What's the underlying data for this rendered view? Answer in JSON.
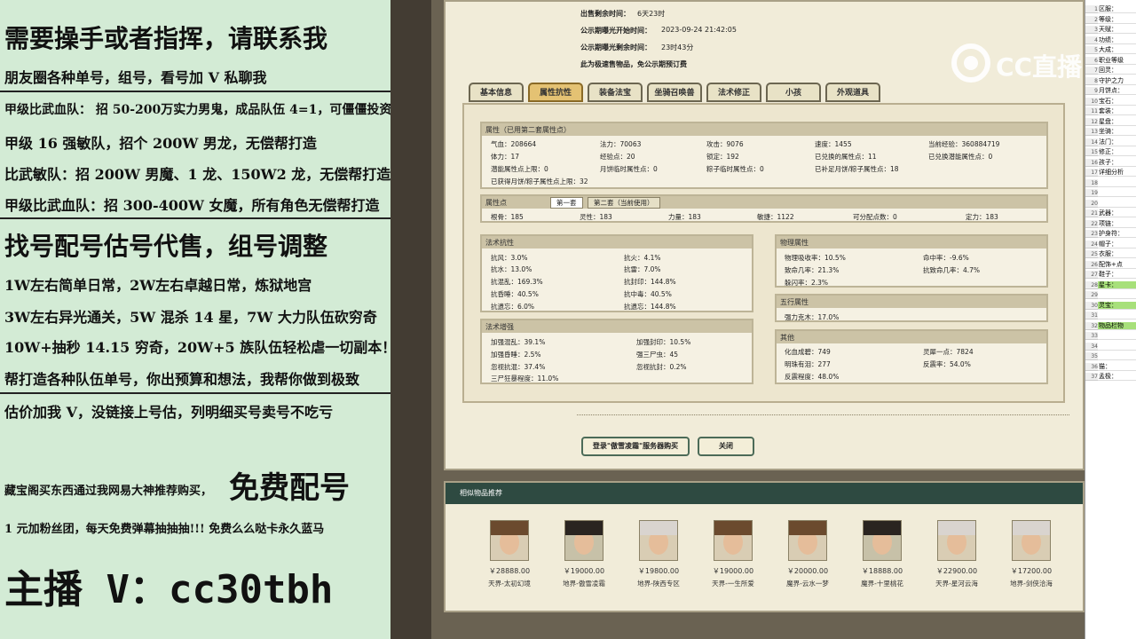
{
  "left_ad": {
    "line1": "需要操手或者指挥，请联系我",
    "line2": "朋友圈各种单号，组号，看号加 V 私聊我",
    "line3": "甲级比武血队： 招 50-200万实力男鬼，成品队伍 4=1，可僵僵投资",
    "line4": "甲级 16 强敏队，招个 200W 男龙，无偿帮打造",
    "line5": "比武敏队：招 200W 男魔、1 龙、150W2 龙，无偿帮打造",
    "line6": "甲级比武血队：招 300-400W 女魔，所有角色无偿帮打造",
    "line7": "找号配号估号代售，组号调整",
    "line8": "1W左右简单日常，2W左右卓越日常，炼狱地宫",
    "line9": "3W左右异光通关，5W 混杀 14 星，7W 大力队伍砍穷奇",
    "line10": "10W+抽秒 14.15 穷奇，20W+5 族队伍轻松虐一切副本！",
    "line11": "帮打造各种队伍单号，你出预算和想法，我帮你做到极致",
    "line12": "估价加我 V，没链接上号估，列明细买号卖号不吃亏",
    "line13a": "藏宝阁买东西通过我网易大神推荐购买，",
    "line13b": "免费配号",
    "line14": "1 元加粉丝团，每天免费弹幕抽抽抽!!! 免费么么哒卡永久蓝马",
    "line15": "主播 V：cc30tbh"
  },
  "sale_info": {
    "label1": "出售剩余时间：",
    "value1": "6天23时",
    "label2": "公示期曝光开始时间：",
    "value2": "2023-09-24 21:42:05",
    "label3": "公示期曝光剩余时间：",
    "value3": "23时43分",
    "note": "此为极速售物品，免公示期预订费"
  },
  "tabs": [
    "基本信息",
    "属性抗性",
    "装备法宝",
    "坐骑召唤兽",
    "法术修正",
    "小孩",
    "外观道具"
  ],
  "attr": {
    "header": "属性（已用第二套属性点）",
    "rows": [
      [
        "气血：208664",
        "法力：70063",
        "攻击：9076",
        "速度：1455",
        "当前经验：360884719"
      ],
      [
        "体力：17",
        "经验点：20",
        "锁定：192",
        "已兑换的属性点：11",
        "已兑换潜能属性点：0"
      ],
      [
        "潜能属性点上限：0",
        "月饼临时属性点：0",
        "粽子临时属性点：0",
        "已补足月饼/粽子属性点：18",
        ""
      ]
    ],
    "note": "已获得月饼/粽子属性点上限：32"
  },
  "points": {
    "header": "属性点",
    "sub1": "第一套",
    "sub2": "第二套（当前使用）",
    "row": [
      "根骨：185",
      "灵性：183",
      "力量：183",
      "敏捷：1122",
      "可分配点数：0",
      "定力：183"
    ]
  },
  "fashu_kang": {
    "header": "法术抗性",
    "rows": [
      [
        "抗风：3.0%",
        "抗火：4.1%"
      ],
      [
        "抗水：13.0%",
        "抗雷：7.0%"
      ],
      [
        "抗混乱：169.3%",
        "抗封印：144.8%"
      ],
      [
        "抗昏睡：40.5%",
        "抗中毒：40.5%"
      ],
      [
        "抗遗忘：6.0%",
        "抗遗忘：144.8%"
      ]
    ]
  },
  "fashu_zeng": {
    "header": "法术增强",
    "rows": [
      [
        "加强混乱：39.1%",
        "加强封印：10.5%"
      ],
      [
        "加强昏睡：2.5%",
        "强三尸虫：45"
      ],
      [
        "忽视抗混：37.4%",
        "忽视抗封：0.2%"
      ],
      [
        "三尸狂暴程度：11.0%",
        ""
      ]
    ]
  },
  "wuli": {
    "header": "物理属性",
    "rows": [
      [
        "物理吸收率：10.5%",
        "命中率：-9.6%"
      ],
      [
        "致命几率：21.3%",
        "抗致命几率：4.7%"
      ],
      [
        "躲闪率：2.3%",
        ""
      ]
    ]
  },
  "wuxing": {
    "header": "五行属性",
    "row": "强力克木：17.0%"
  },
  "other": {
    "header": "其他",
    "rows": [
      [
        "化血成碧：749",
        "灵犀一点：7824"
      ],
      [
        "明珠有泪：277",
        "反震率：54.0%"
      ],
      [
        "反震程度：48.0%",
        ""
      ]
    ]
  },
  "buttons": {
    "login": "登录\"傲雪凌霜\"服务器购买",
    "close": "关闭"
  },
  "rec": {
    "header": "相似物品推荐",
    "items": [
      {
        "price": "￥28888.00",
        "server": "天界-太初幻境",
        "hair": "#6b4a2e"
      },
      {
        "price": "￥19000.00",
        "server": "地界-傲雪凌霜",
        "hair": "#2a2420"
      },
      {
        "price": "￥19800.00",
        "server": "地界-陕西专区",
        "hair": "#d9d4cf"
      },
      {
        "price": "￥19000.00",
        "server": "天界-一生所爱",
        "hair": "#6b4a2e"
      },
      {
        "price": "￥20000.00",
        "server": "魔界-云水一梦",
        "hair": "#6b4a2e"
      },
      {
        "price": "￥18888.00",
        "server": "魔界-十里桃花",
        "hair": "#2a2420"
      },
      {
        "price": "￥22900.00",
        "server": "天界-星河云海",
        "hair": "#d9d4cf"
      },
      {
        "price": "￥17200.00",
        "server": "地界-剑侠洽海",
        "hair": "#d9d4cf"
      }
    ]
  },
  "logo": {
    "text": "CC直播"
  },
  "sheet": {
    "rows": [
      {
        "n": "1",
        "v": "区服：",
        "g": false
      },
      {
        "n": "2",
        "v": "等级：",
        "g": false
      },
      {
        "n": "3",
        "v": "天赋：",
        "g": false
      },
      {
        "n": "4",
        "v": "功绩：",
        "g": false
      },
      {
        "n": "5",
        "v": "大成：",
        "g": false
      },
      {
        "n": "6",
        "v": "职业等级",
        "g": false
      },
      {
        "n": "7",
        "v": "回灵：",
        "g": false
      },
      {
        "n": "8",
        "v": "守护之力",
        "g": false
      },
      {
        "n": "9",
        "v": "月饼点：",
        "g": false
      },
      {
        "n": "10",
        "v": "宝石：",
        "g": false
      },
      {
        "n": "11",
        "v": "套装：",
        "g": false
      },
      {
        "n": "12",
        "v": "星盘：",
        "g": false
      },
      {
        "n": "13",
        "v": "坐骑：",
        "g": false
      },
      {
        "n": "14",
        "v": "法门：",
        "g": false
      },
      {
        "n": "15",
        "v": "修正：",
        "g": false
      },
      {
        "n": "16",
        "v": "孩子：",
        "g": false
      },
      {
        "n": "17",
        "v": "详细分析",
        "g": false
      },
      {
        "n": "18",
        "v": "",
        "g": false
      },
      {
        "n": "19",
        "v": "",
        "g": false
      },
      {
        "n": "20",
        "v": "",
        "g": false
      },
      {
        "n": "21",
        "v": "武器：",
        "g": false
      },
      {
        "n": "22",
        "v": "项链：",
        "g": false
      },
      {
        "n": "23",
        "v": "护身符：",
        "g": false
      },
      {
        "n": "24",
        "v": "帽子：",
        "g": false
      },
      {
        "n": "25",
        "v": "衣服：",
        "g": false
      },
      {
        "n": "26",
        "v": "配饰+点",
        "g": false
      },
      {
        "n": "27",
        "v": "鞋子：",
        "g": false
      },
      {
        "n": "28",
        "v": "星卡：",
        "g": true
      },
      {
        "n": "29",
        "v": "",
        "g": false
      },
      {
        "n": "30",
        "v": "灵宝：",
        "g": true
      },
      {
        "n": "31",
        "v": "",
        "g": false
      },
      {
        "n": "32",
        "v": "物品栏物",
        "g": true
      },
      {
        "n": "33",
        "v": "",
        "g": false
      },
      {
        "n": "34",
        "v": "",
        "g": false
      },
      {
        "n": "35",
        "v": "",
        "g": false
      },
      {
        "n": "36",
        "v": "猫：",
        "g": false
      },
      {
        "n": "37",
        "v": "孟极：",
        "g": false
      }
    ]
  }
}
